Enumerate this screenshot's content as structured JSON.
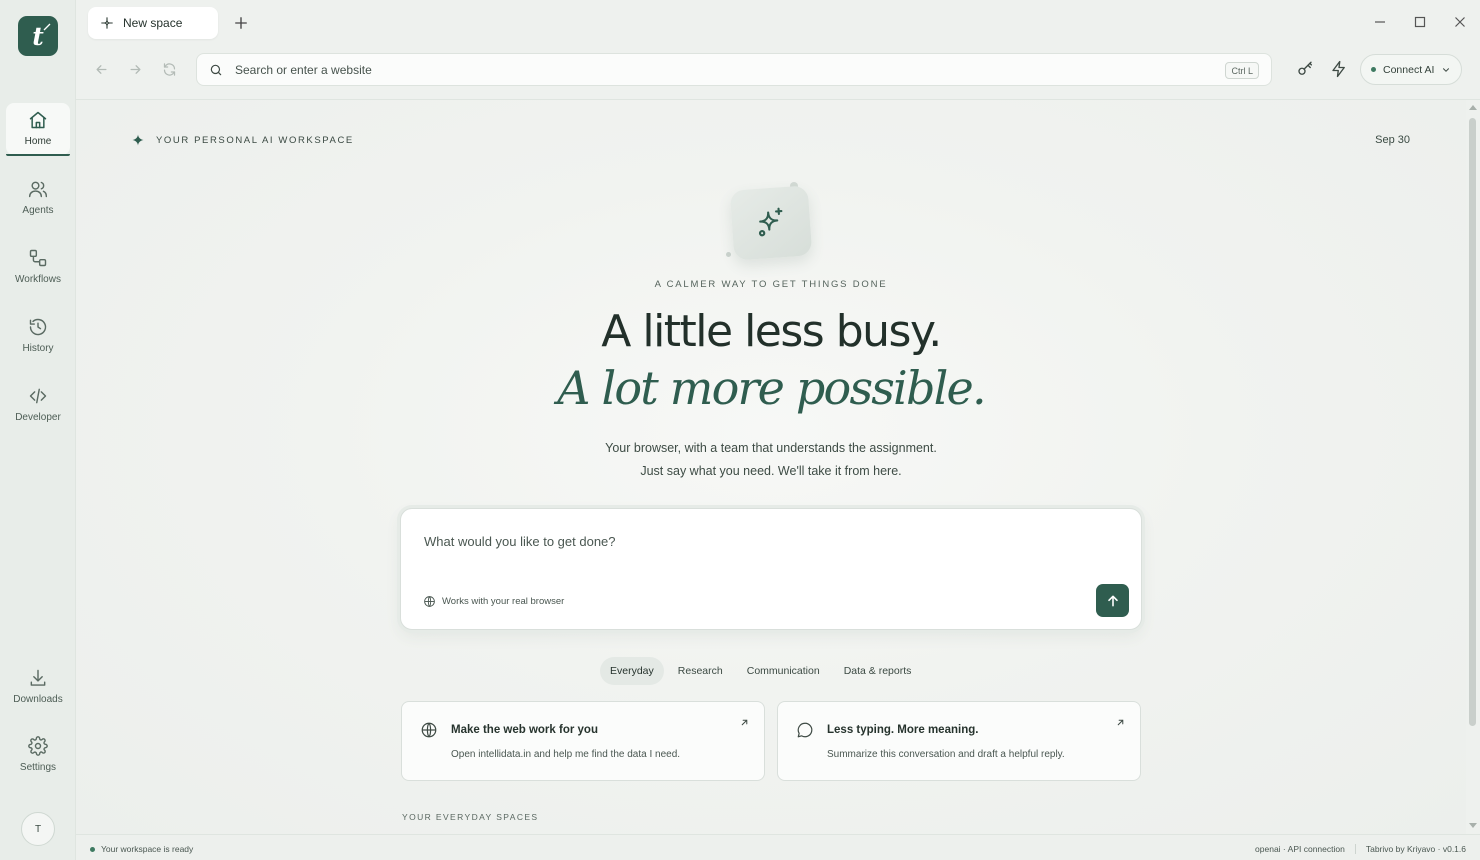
{
  "app": {
    "logo_letter": "t",
    "tab_title": "New space",
    "omnibox_placeholder": "Search or enter a website",
    "omnibox_shortcut": "Ctrl L",
    "connect_label": "Connect AI"
  },
  "sidebar": {
    "items": [
      {
        "label": "Home",
        "icon": "home-icon",
        "active": true
      },
      {
        "label": "Agents",
        "icon": "users-icon"
      },
      {
        "label": "Workflows",
        "icon": "workflow-icon"
      },
      {
        "label": "History",
        "icon": "history-icon"
      },
      {
        "label": "Developer",
        "icon": "code-icon"
      }
    ],
    "bottom": [
      {
        "label": "Downloads",
        "icon": "download-icon"
      },
      {
        "label": "Settings",
        "icon": "gear-icon"
      }
    ],
    "avatar_initial": "T"
  },
  "main": {
    "eyebrow": "YOUR PERSONAL AI WORKSPACE",
    "date": "Sep 30",
    "tagline": "A CALMER WAY TO GET THINGS DONE",
    "headline_line1": "A little less busy.",
    "headline_line2": "A lot more possible.",
    "subtitle_line1": "Your browser, with a team that understands the assignment.",
    "subtitle_line2": "Just say what you need. We'll take it from here.",
    "composer": {
      "placeholder": "What would you like to get done?",
      "hint": "Works with your real browser"
    },
    "categories": [
      "Everyday",
      "Research",
      "Communication",
      "Data & reports"
    ],
    "active_category": "Everyday",
    "cards": [
      {
        "title": "Make the web work for you",
        "description": "Open intellidata.in and help me find the data I need.",
        "icon": "globe-icon"
      },
      {
        "title": "Less typing. More meaning.",
        "description": "Summarize this conversation and draft a helpful reply.",
        "icon": "chat-bubble-icon"
      }
    ],
    "spaces_label": "YOUR EVERYDAY SPACES"
  },
  "status": {
    "left": "Your workspace is ready",
    "connection": "openai · API connection",
    "version": "Tabrivo by Kriyavo · v0.1.6"
  },
  "colors": {
    "accent": "#2f5d4f",
    "background": "#eef1ee"
  }
}
